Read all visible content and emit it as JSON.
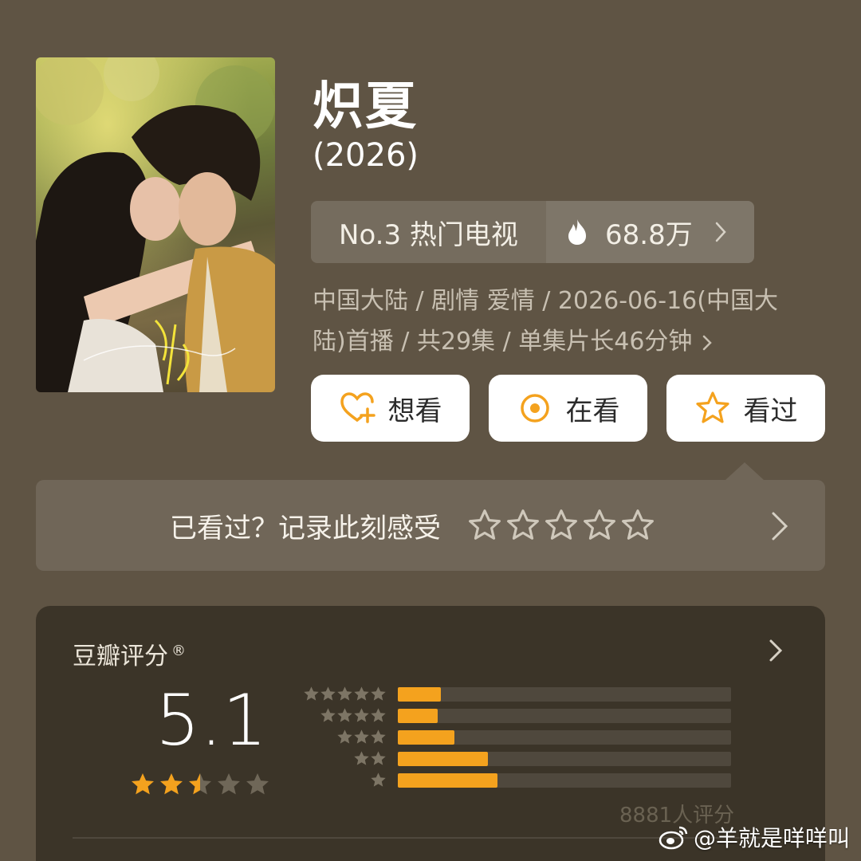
{
  "title": "炽夏",
  "year": "(2026)",
  "rank": {
    "label": "No.3 热门电视",
    "heat": "68.8万"
  },
  "meta": {
    "line1": "中国大陆 / 剧情 爱情 / 2026-06-16(中国大",
    "line2": "陆)首播 / 共29集 / 单集片长46分钟"
  },
  "actions": {
    "want": "想看",
    "watching": "在看",
    "watched": "看过"
  },
  "record": {
    "text": "已看过？记录此刻感受",
    "star_count": 5
  },
  "rating": {
    "header": "豆瓣评分",
    "registered": "®",
    "score": "5.1",
    "score_stars": 2.5,
    "distribution": [
      {
        "stars": 5,
        "fraction": 0.13
      },
      {
        "stars": 4,
        "fraction": 0.12
      },
      {
        "stars": 3,
        "fraction": 0.17
      },
      {
        "stars": 2,
        "fraction": 0.27
      },
      {
        "stars": 1,
        "fraction": 0.3
      }
    ],
    "raters": "8881人评分"
  },
  "watermark": "@羊就是咩咩叫",
  "colors": {
    "background": "#5f5444",
    "accent_orange": "#f4a21e",
    "card": "#3b3428"
  },
  "icons": {
    "want": "heart-plus-icon",
    "watching": "target-circle-icon",
    "watched": "star-outline-icon",
    "heat": "fire-icon",
    "watermark": "weibo-icon"
  }
}
